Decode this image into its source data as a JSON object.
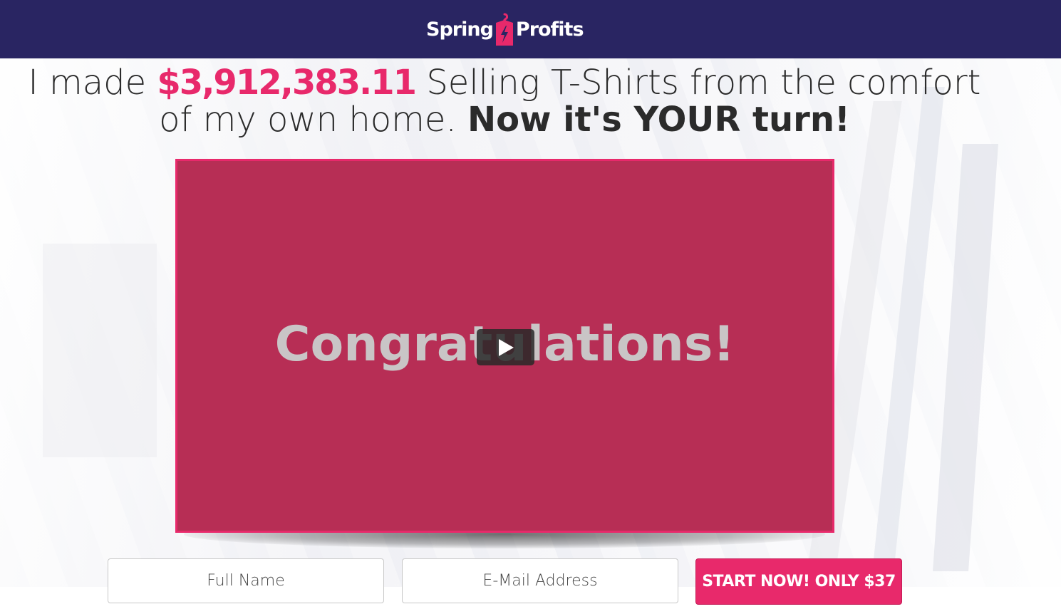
{
  "brand": {
    "name_left": "Spring",
    "name_right": "Profits",
    "accent_color": "#e8296b",
    "header_color": "#292562"
  },
  "headline": {
    "part1": "I made ",
    "money": "$3,912,383.11",
    "part2": " Selling T-Shirts from the comfort of my own home. ",
    "bold": "Now it's YOUR turn!"
  },
  "video": {
    "title_text": "Congratulations!",
    "play_icon": "play-icon"
  },
  "form": {
    "name_placeholder": "Full Name",
    "email_placeholder": "E-Mail Address",
    "cta_label": "START NOW! ONLY $37"
  }
}
